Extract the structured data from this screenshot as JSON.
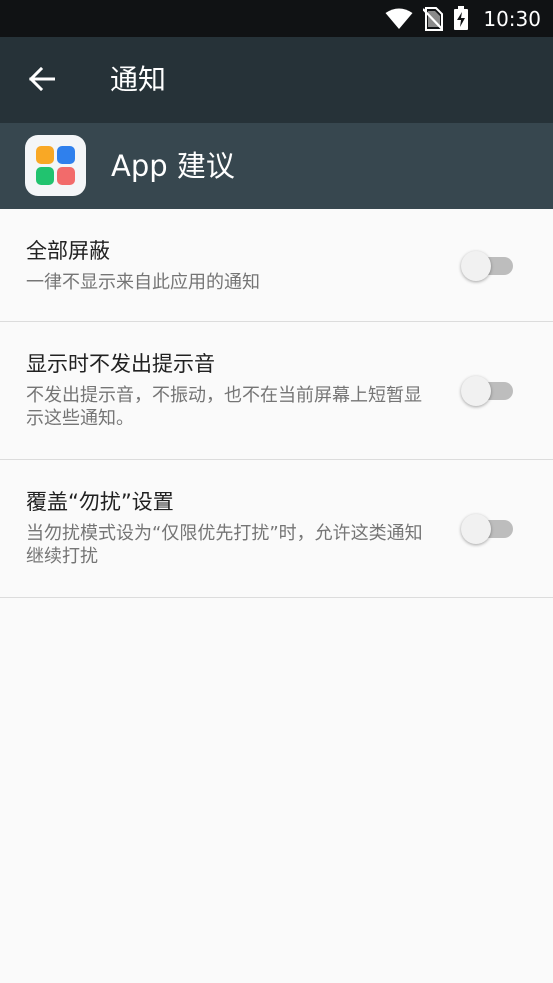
{
  "status_bar": {
    "time": "10:30",
    "icons": [
      "wifi-icon",
      "no-sim-icon",
      "battery-charging-icon"
    ]
  },
  "app_bar": {
    "back_icon": "arrow-left-icon",
    "title": "通知"
  },
  "app_header": {
    "icon": "app-grid-icon",
    "app_name": "App 建议"
  },
  "settings": [
    {
      "title": "全部屏蔽",
      "summary": "一律不显示来自此应用的通知",
      "enabled": false
    },
    {
      "title": "显示时不发出提示音",
      "summary": "不发出提示音，不振动，也不在当前屏幕上短暂显示这些通知。",
      "enabled": false
    },
    {
      "title": "覆盖“勿扰”设置",
      "summary": "当勿扰模式设为“仅限优先打扰”时，允许这类通知继续打扰",
      "enabled": false
    }
  ],
  "colors": {
    "status_bar": "#101214",
    "app_bar": "#263238",
    "app_header": "#37474f",
    "background": "#fafafa"
  }
}
